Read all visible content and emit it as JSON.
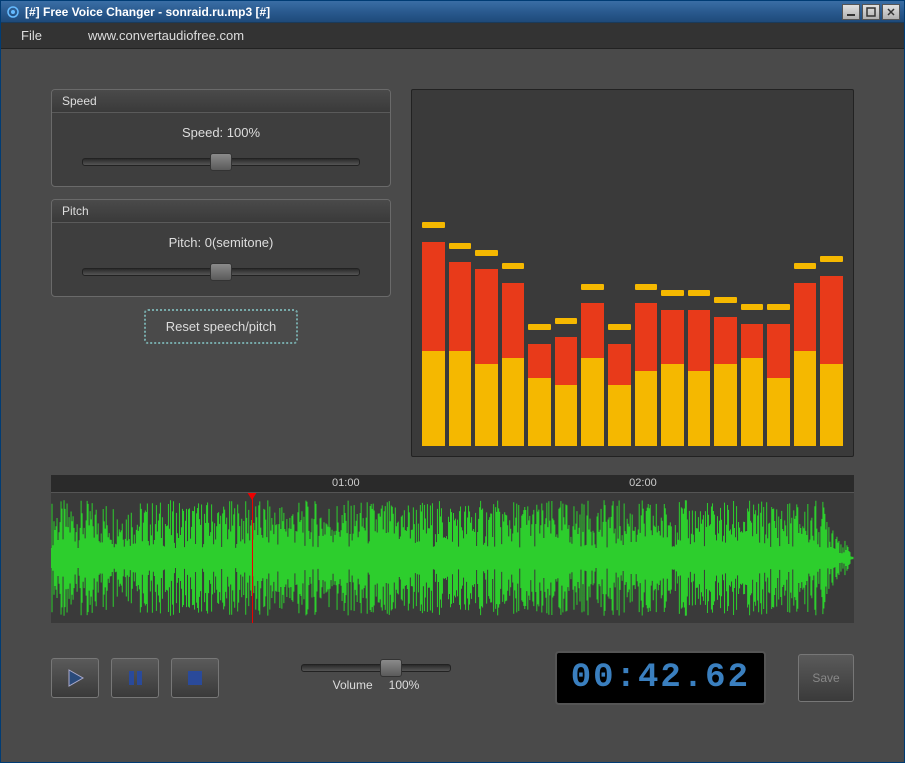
{
  "window": {
    "title": "[#] Free Voice Changer - sonraid.ru.mp3 [#]"
  },
  "menu": {
    "file": "File",
    "url": "www.convertaudiofree.com"
  },
  "speed": {
    "header": "Speed",
    "label": "Speed: 100%",
    "position_pct": 50
  },
  "pitch": {
    "header": "Pitch",
    "label": "Pitch: 0(semitone)",
    "position_pct": 50
  },
  "reset_label": "Reset speech/pitch",
  "visualizer_bars": [
    {
      "yellow": 28,
      "red": 32,
      "cap": 64
    },
    {
      "yellow": 28,
      "red": 26,
      "cap": 58
    },
    {
      "yellow": 24,
      "red": 28,
      "cap": 56
    },
    {
      "yellow": 26,
      "red": 22,
      "cap": 52
    },
    {
      "yellow": 20,
      "red": 10,
      "cap": 34
    },
    {
      "yellow": 18,
      "red": 14,
      "cap": 36
    },
    {
      "yellow": 26,
      "red": 16,
      "cap": 46
    },
    {
      "yellow": 18,
      "red": 12,
      "cap": 34
    },
    {
      "yellow": 22,
      "red": 20,
      "cap": 46
    },
    {
      "yellow": 24,
      "red": 16,
      "cap": 44
    },
    {
      "yellow": 22,
      "red": 18,
      "cap": 44
    },
    {
      "yellow": 24,
      "red": 14,
      "cap": 42
    },
    {
      "yellow": 26,
      "red": 10,
      "cap": 40
    },
    {
      "yellow": 20,
      "red": 16,
      "cap": 40
    },
    {
      "yellow": 28,
      "red": 20,
      "cap": 52
    },
    {
      "yellow": 24,
      "red": 26,
      "cap": 54
    }
  ],
  "timeline": {
    "marks": [
      {
        "label": "01:00",
        "pos_pct": 35
      },
      {
        "label": "02:00",
        "pos_pct": 72
      }
    ],
    "playhead_pct": 25
  },
  "volume": {
    "label": "Volume",
    "value": "100%",
    "position_pct": 60
  },
  "time_display": "00:42.62",
  "save_label": "Save"
}
